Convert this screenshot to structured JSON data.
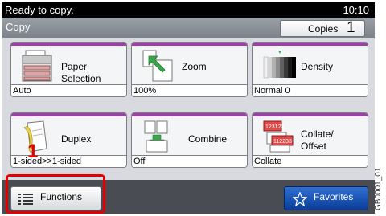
{
  "status": {
    "message": "Ready to copy.",
    "time": "10:10"
  },
  "header": {
    "screen_name": "Copy",
    "copies_label": "Copies",
    "copies_value": "1"
  },
  "tiles": [
    {
      "label": "Paper Selection",
      "value": "Auto",
      "icon": "paper-tray-icon"
    },
    {
      "label": "Zoom",
      "value": "100%",
      "icon": "zoom-icon"
    },
    {
      "label": "Density",
      "value": "Normal 0",
      "icon": "density-icon"
    },
    {
      "label": "Duplex",
      "value": "1-sided>>1-sided",
      "icon": "duplex-icon"
    },
    {
      "label": "Combine",
      "value": "Off",
      "icon": "combine-icon"
    },
    {
      "label": "Collate/ Offset",
      "value": "Collate",
      "icon": "collate-icon"
    }
  ],
  "bottom": {
    "functions_label": "Functions",
    "favorites_label": "Favorites"
  },
  "annotation": {
    "callout_number": "1",
    "figure_code": "GB0001_01"
  },
  "colors": {
    "tile_accent": "#9c3fa6",
    "highlight": "#e40000",
    "favorites": "#1a52b8"
  }
}
